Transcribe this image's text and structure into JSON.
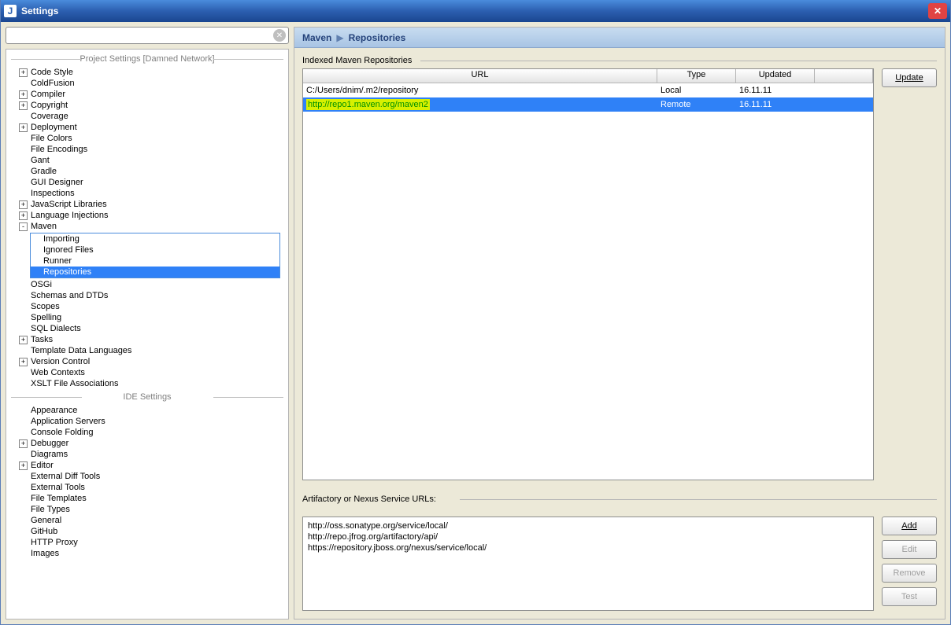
{
  "window": {
    "title": "Settings"
  },
  "search": {
    "placeholder": ""
  },
  "sections": {
    "project": "Project Settings [Damned Network]",
    "ide": "IDE Settings"
  },
  "tree": {
    "project": [
      {
        "label": "Code Style",
        "exp": "+"
      },
      {
        "label": "ColdFusion"
      },
      {
        "label": "Compiler",
        "exp": "+"
      },
      {
        "label": "Copyright",
        "exp": "+"
      },
      {
        "label": "Coverage"
      },
      {
        "label": "Deployment",
        "exp": "+"
      },
      {
        "label": "File Colors"
      },
      {
        "label": "File Encodings"
      },
      {
        "label": "Gant"
      },
      {
        "label": "Gradle"
      },
      {
        "label": "GUI Designer"
      },
      {
        "label": "Inspections"
      },
      {
        "label": "JavaScript Libraries",
        "exp": "+"
      },
      {
        "label": "Language Injections",
        "exp": "+"
      },
      {
        "label": "Maven",
        "exp": "-",
        "children": [
          {
            "label": "Importing"
          },
          {
            "label": "Ignored Files"
          },
          {
            "label": "Runner"
          },
          {
            "label": "Repositories",
            "selected": true
          }
        ]
      },
      {
        "label": "OSGi"
      },
      {
        "label": "Schemas and DTDs"
      },
      {
        "label": "Scopes"
      },
      {
        "label": "Spelling"
      },
      {
        "label": "SQL Dialects"
      },
      {
        "label": "Tasks",
        "exp": "+"
      },
      {
        "label": "Template Data Languages"
      },
      {
        "label": "Version Control",
        "exp": "+"
      },
      {
        "label": "Web Contexts"
      },
      {
        "label": "XSLT File Associations"
      }
    ],
    "ide": [
      {
        "label": "Appearance"
      },
      {
        "label": "Application Servers"
      },
      {
        "label": "Console Folding"
      },
      {
        "label": "Debugger",
        "exp": "+"
      },
      {
        "label": "Diagrams"
      },
      {
        "label": "Editor",
        "exp": "+"
      },
      {
        "label": "External Diff Tools"
      },
      {
        "label": "External Tools"
      },
      {
        "label": "File Templates"
      },
      {
        "label": "File Types"
      },
      {
        "label": "General"
      },
      {
        "label": "GitHub"
      },
      {
        "label": "HTTP Proxy"
      },
      {
        "label": "Images"
      }
    ]
  },
  "breadcrumb": {
    "root": "Maven",
    "leaf": "Repositories"
  },
  "repos": {
    "label": "Indexed Maven Repositories",
    "headers": {
      "url": "URL",
      "type": "Type",
      "updated": "Updated"
    },
    "rows": [
      {
        "url": "C:/Users/dnim/.m2/repository",
        "type": "Local",
        "updated": "16.11.11"
      },
      {
        "url": "http://repo1.maven.org/maven2",
        "type": "Remote",
        "updated": "16.11.11",
        "selected": true,
        "highlight": true
      }
    ]
  },
  "buttons": {
    "update": "Update",
    "add": "Add",
    "edit": "Edit",
    "remove": "Remove",
    "test": "Test"
  },
  "service": {
    "label": "Artifactory or Nexus Service URLs:",
    "items": [
      "http://oss.sonatype.org/service/local/",
      "http://repo.jfrog.org/artifactory/api/",
      "https://repository.jboss.org/nexus/service/local/"
    ]
  }
}
